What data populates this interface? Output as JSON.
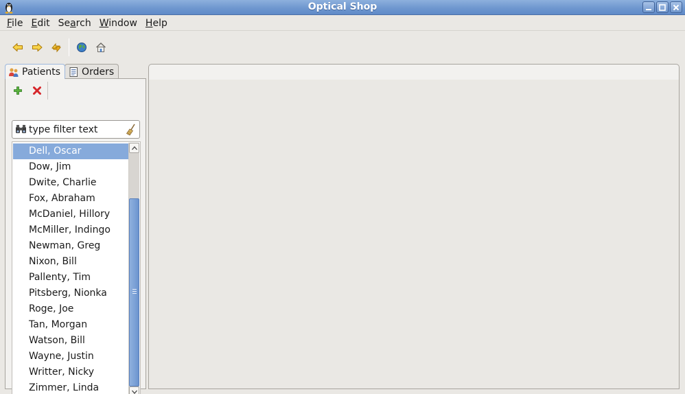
{
  "window": {
    "title": "Optical Shop",
    "controls": [
      "minimize-icon",
      "maximize-icon",
      "close-icon"
    ]
  },
  "menu": [
    {
      "label": "File",
      "mnemonic": "F",
      "rest": "ile"
    },
    {
      "label": "Edit",
      "mnemonic": "E",
      "rest": "dit"
    },
    {
      "label": "Search",
      "mnemonic": "a",
      "pre": "Se",
      "rest": "rch"
    },
    {
      "label": "Window",
      "mnemonic": "W",
      "rest": "indow"
    },
    {
      "label": "Help",
      "mnemonic": "H",
      "rest": "elp"
    }
  ],
  "toolbar": {
    "buttons": [
      "back-arrow-icon",
      "forward-arrow-icon",
      "sync-icon",
      "globe-icon",
      "home-icon"
    ]
  },
  "left_view": {
    "tabs": [
      {
        "label": "Patients",
        "icon": "patients-icon",
        "active": true
      },
      {
        "label": "Orders",
        "icon": "orders-icon",
        "active": false
      }
    ],
    "actions": [
      "add-icon",
      "delete-icon"
    ],
    "filter": {
      "placeholder": "type filter text"
    },
    "patients": [
      "Dell, Oscar",
      "Dow, Jim",
      "Dwite, Charlie",
      "Fox, Abraham",
      "McDaniel, Hillory",
      "McMiller, Indingo",
      "Newman, Greg",
      "Nixon, Bill",
      "Pallenty, Tim",
      "Pitsberg, Nionka",
      "Roge, Joe",
      "Tan, Morgan",
      "Watson, Bill",
      "Wayne, Justin",
      "Writter, Nicky",
      "Zimmer, Linda"
    ],
    "selected_index": 0
  },
  "colors": {
    "titlebar": "#6f97cf",
    "selection": "#86aadb",
    "background": "#eae8e4"
  }
}
